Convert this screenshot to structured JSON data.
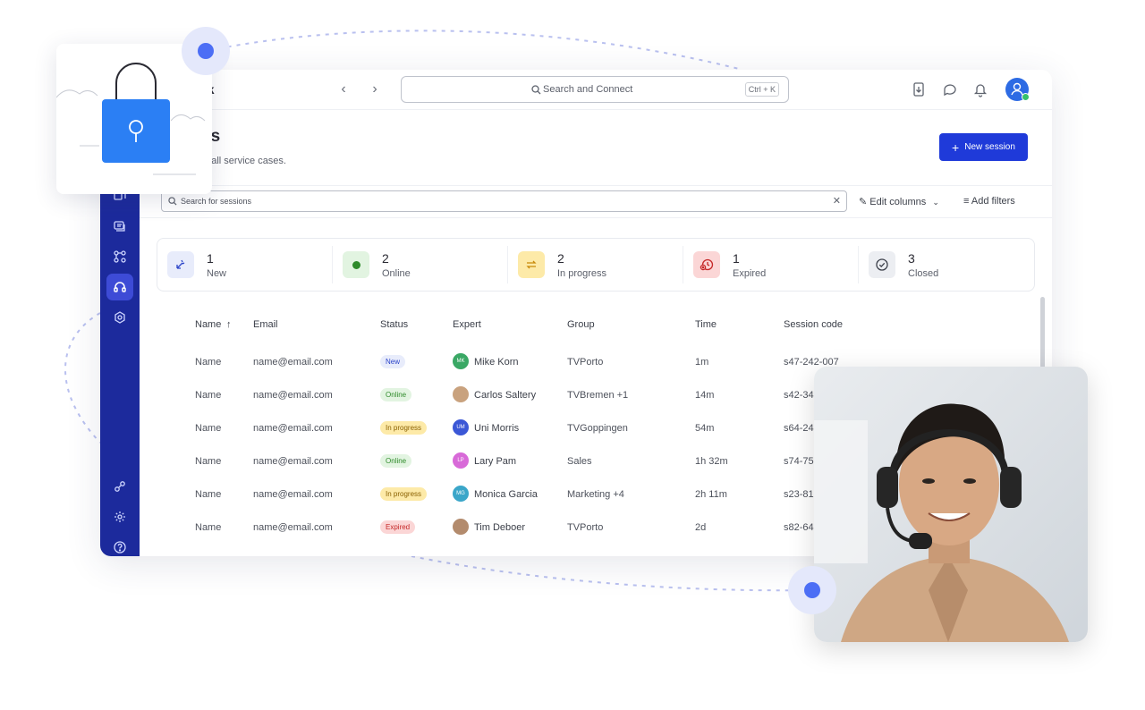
{
  "colors": {
    "accent": "#1f3ad9",
    "sidebar": "#1c2a9c",
    "online": "#36c26b"
  },
  "header": {
    "brand": "sk",
    "search_placeholder": "Search and Connect",
    "search_shortcut": "Ctrl + K",
    "icons": [
      "chevron-left-icon",
      "chevron-right-icon",
      "download-icon",
      "chat-icon",
      "bell-icon",
      "user-avatar-icon"
    ]
  },
  "page": {
    "title": "ns",
    "subtitle": "of all service cases.",
    "new_session_label": "New session"
  },
  "filters": {
    "search_placeholder": "Search for sessions",
    "edit_columns_label": "Edit columns",
    "add_filters_label": "Add filters"
  },
  "stats": [
    {
      "count": "1",
      "label": "New"
    },
    {
      "count": "2",
      "label": "Online"
    },
    {
      "count": "2",
      "label": "In progress"
    },
    {
      "count": "1",
      "label": "Expired"
    },
    {
      "count": "3",
      "label": "Closed"
    }
  ],
  "table": {
    "columns": [
      "Name",
      "Email",
      "Status",
      "Expert",
      "Group",
      "Time",
      "Session code"
    ],
    "sort_indicator": "↑",
    "rows": [
      {
        "name": "Name",
        "email": "name@email.com",
        "status": "New",
        "expert_initials": "MK",
        "expert": "Mike Korn",
        "group": "TVPorto",
        "time": "1m",
        "code": "s47-242-007"
      },
      {
        "name": "Name",
        "email": "name@email.com",
        "status": "Online",
        "expert_initials": "",
        "expert": "Carlos Saltery",
        "group": "TVBremen +1",
        "time": "14m",
        "code": "s42-34"
      },
      {
        "name": "Name",
        "email": "name@email.com",
        "status": "In progress",
        "expert_initials": "UM",
        "expert": "Uni Morris",
        "group": "TVGoppingen",
        "time": "54m",
        "code": "s64-24"
      },
      {
        "name": "Name",
        "email": "name@email.com",
        "status": "Online",
        "expert_initials": "LP",
        "expert": "Lary Pam",
        "group": "Sales",
        "time": "1h 32m",
        "code": "s74-75"
      },
      {
        "name": "Name",
        "email": "name@email.com",
        "status": "In progress",
        "expert_initials": "MG",
        "expert": "Monica Garcia",
        "group": "Marketing +4",
        "time": "2h 11m",
        "code": "s23-81"
      },
      {
        "name": "Name",
        "email": "name@email.com",
        "status": "Expired",
        "expert_initials": "",
        "expert": "Tim Deboer",
        "group": "TVPorto",
        "time": "2d",
        "code": "s82-64"
      }
    ]
  }
}
